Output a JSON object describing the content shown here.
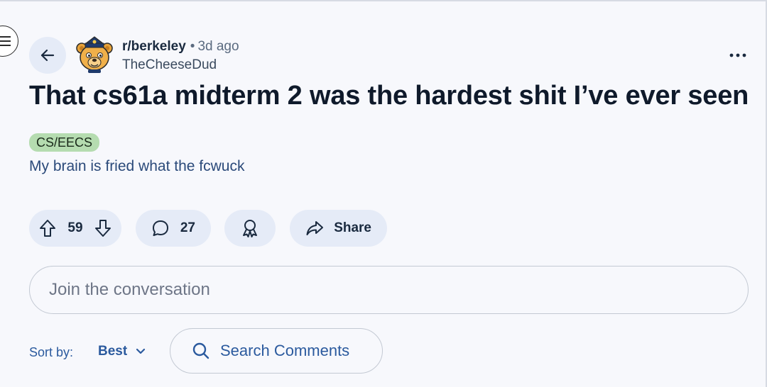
{
  "post": {
    "subreddit": "r/berkeley",
    "separator": "•",
    "time_ago": "3d ago",
    "author": "TheCheeseDud",
    "title": "That cs61a midterm 2 was the hardest shit I’ve ever seen",
    "flair": "CS/EECS",
    "body": "My brain is fried what the fcwuck"
  },
  "actions": {
    "vote_count": "59",
    "comment_count": "27",
    "share_label": "Share"
  },
  "comment_box": {
    "placeholder": "Join the conversation"
  },
  "sort": {
    "label": "Sort by:",
    "value": "Best"
  },
  "search": {
    "label": "Search Comments"
  },
  "icons": {
    "menu": "hamburger-icon",
    "back": "arrow-left-icon",
    "more": "ellipsis-icon",
    "upvote": "arrow-up-icon",
    "downvote": "arrow-down-icon",
    "comment": "speech-bubble-icon",
    "award": "award-ribbon-icon",
    "share": "share-arrow-icon",
    "sort_chevron": "chevron-down-icon",
    "search": "search-icon"
  },
  "colors": {
    "background": "#f7f8fc",
    "pill_background": "#e5ebf7",
    "flair_background": "#b5dcb0",
    "link_blue": "#2b5a9e",
    "title": "#0f1a2b"
  }
}
